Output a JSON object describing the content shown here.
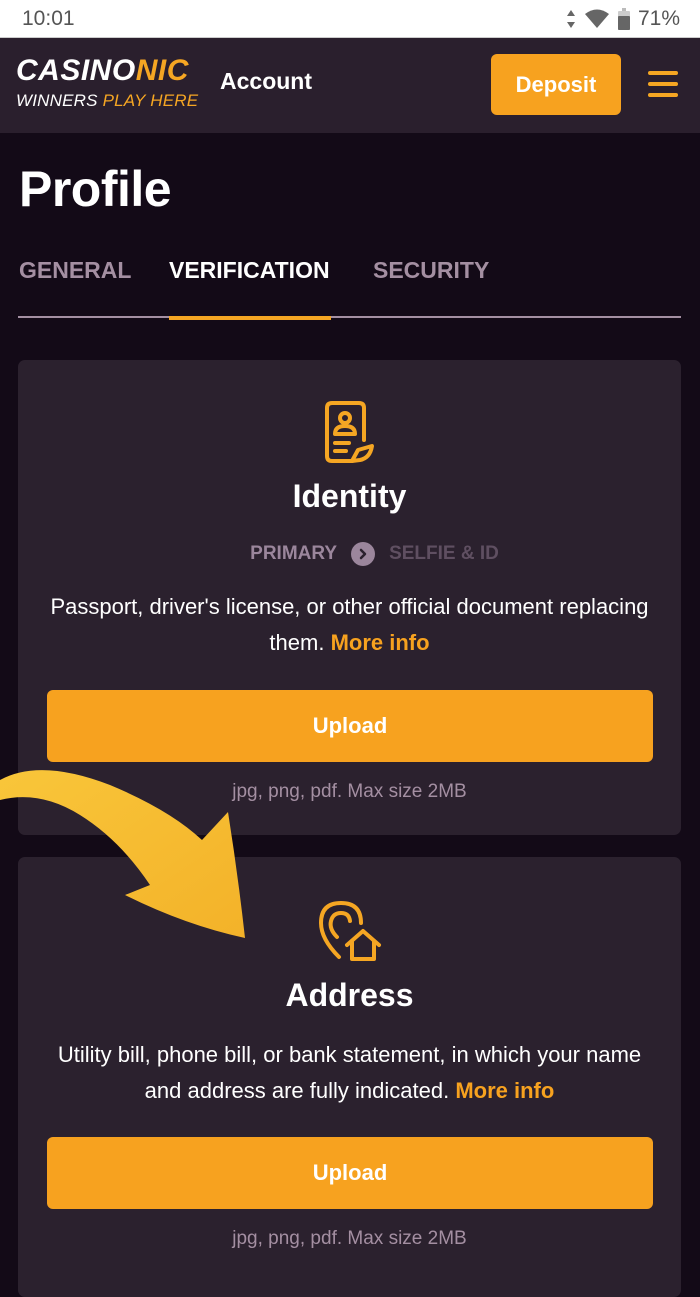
{
  "status_bar": {
    "time": "10:01",
    "battery": "71%"
  },
  "header": {
    "logo": {
      "main_white": "CASINO",
      "main_accent": "NIC",
      "tagline_white": "WINNERS ",
      "tagline_accent": "PLAY HERE"
    },
    "title": "Account",
    "deposit_label": "Deposit"
  },
  "page": {
    "title": "Profile",
    "tabs": [
      {
        "label": "GENERAL",
        "active": false
      },
      {
        "label": "VERIFICATION",
        "active": true
      },
      {
        "label": "SECURITY",
        "active": false
      }
    ]
  },
  "cards": [
    {
      "title": "Identity",
      "steps": [
        "PRIMARY",
        "SELFIE & ID"
      ],
      "description": "Passport, driver's license, or other official document replacing them.",
      "more_info": "More info",
      "upload_label": "Upload",
      "file_hint": "jpg, png, pdf. Max size 2MB"
    },
    {
      "title": "Address",
      "description": "Utility bill, phone bill, or bank statement, in which your name and address are fully indicated.",
      "more_info": "More info",
      "upload_label": "Upload",
      "file_hint": "jpg, png, pdf. Max size 2MB"
    }
  ],
  "colors": {
    "accent": "#f7a21f",
    "background": "#130a17",
    "header": "#2a1f2d",
    "card": "#2b212e",
    "muted_text": "#a48fa2"
  }
}
